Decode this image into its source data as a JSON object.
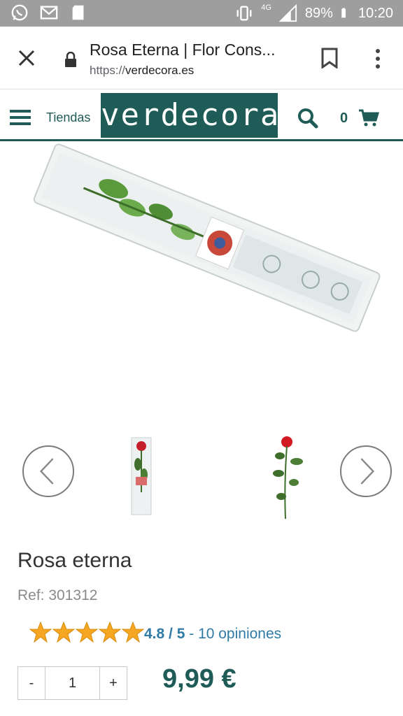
{
  "status_bar": {
    "icons": [
      "whatsapp-icon",
      "gmail-icon",
      "sd-card-icon",
      "vibrate-icon",
      "signal-icon",
      "battery-icon"
    ],
    "network": "4G",
    "battery": "89%",
    "time": "10:20"
  },
  "browser": {
    "title": "Rosa Eterna | Flor Cons...",
    "url_scheme": "https://",
    "url_host": "verdecora.es"
  },
  "header": {
    "stores_label": "Tiendas",
    "logo_text": "verdecora",
    "cart_count": "0",
    "brand_color": "#1f5b57"
  },
  "product": {
    "title": "Rosa eterna",
    "ref": "Ref: 301312",
    "rating": {
      "stars": 5,
      "score": "4.8 / 5",
      "separator": " - ",
      "reviews": "10 opiniones"
    },
    "quantity": {
      "minus_label": "-",
      "value": "1",
      "plus_label": "+"
    },
    "price": "9,99 €"
  }
}
